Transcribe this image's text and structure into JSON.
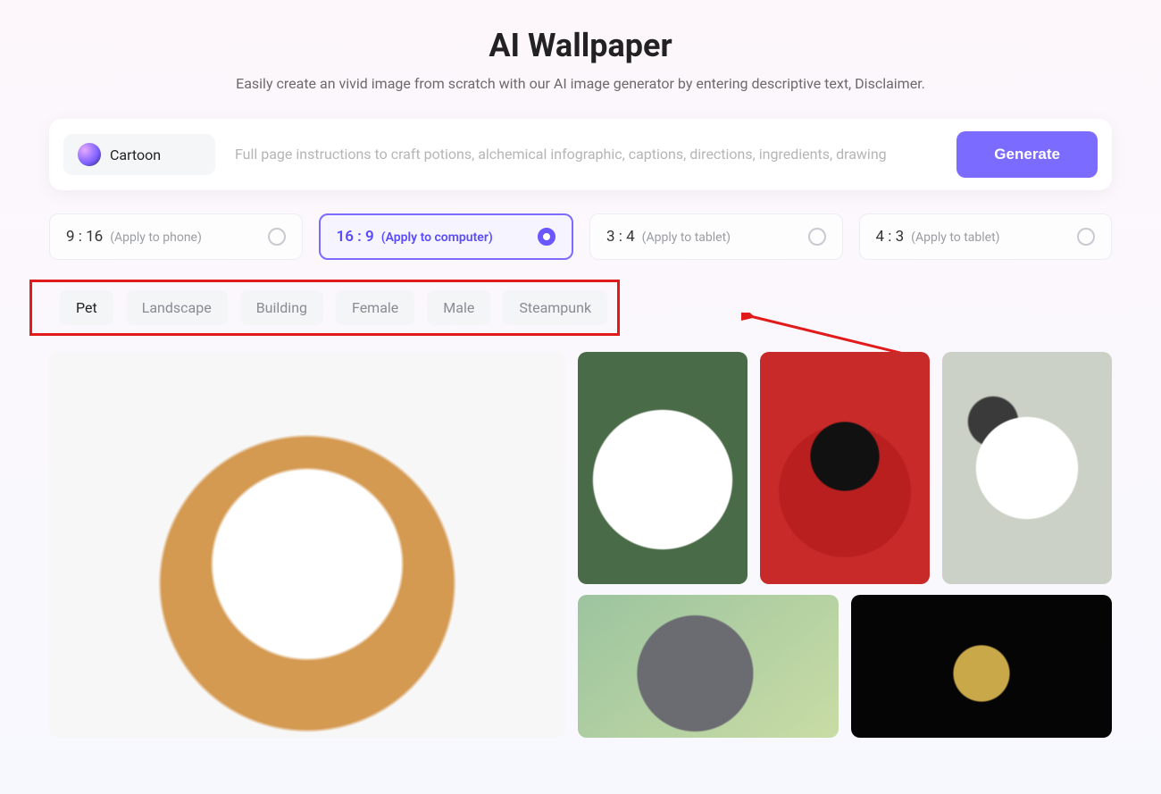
{
  "header": {
    "title": "AI Wallpaper",
    "subtitle": "Easily create an vivid image from scratch with our AI image generator by entering descriptive text, Disclaimer."
  },
  "prompt_bar": {
    "style_label": "Cartoon",
    "placeholder": "Full page instructions to craft potions, alchemical infographic, captions, directions, ingredients, drawing",
    "generate_label": "Generate"
  },
  "ratios": [
    {
      "main": "9 : 16",
      "sub": "(Apply to phone)",
      "selected": false
    },
    {
      "main": "16 : 9",
      "sub": "(Apply to computer)",
      "selected": true
    },
    {
      "main": "3 : 4",
      "sub": "(Apply to tablet)",
      "selected": false
    },
    {
      "main": "4 : 3",
      "sub": "(Apply to tablet)",
      "selected": false
    }
  ],
  "categories": [
    {
      "label": "Pet",
      "active": true
    },
    {
      "label": "Landscape",
      "active": false
    },
    {
      "label": "Building",
      "active": false
    },
    {
      "label": "Female",
      "active": false
    },
    {
      "label": "Male",
      "active": false
    },
    {
      "label": "Steampunk",
      "active": false
    }
  ],
  "gallery": {
    "main": "corgi-cartoon",
    "thumbs_row1": [
      "samoyed-white-dog",
      "cat-red-hoodie",
      "puppy-tricolor"
    ],
    "thumbs_row2": [
      "gray-dragon-creature",
      "turtle-aquarium"
    ]
  }
}
